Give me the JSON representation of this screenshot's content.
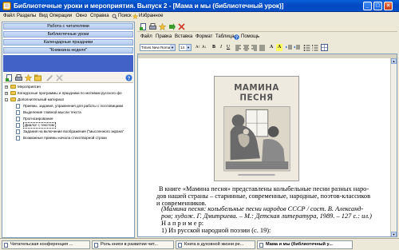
{
  "window": {
    "title": "Библиотечные уроки и мероприятия. Выпуск 2 - [Мама и мы (библиотечный урок)]",
    "controls": {
      "minimize": "_",
      "maximize": "□",
      "close": "×"
    }
  },
  "menubar": [
    "Файл",
    "Разделы",
    "Вид",
    "Операции",
    "Окно",
    "Справка",
    "Поиск",
    "Избранное"
  ],
  "left": {
    "nav": [
      "Работа с читателями",
      "Библиотечные уроки",
      "Календарные праздники",
      "\"Книжкина неделя\""
    ],
    "tree": [
      {
        "label": "Мероприятия",
        "kind": "folder",
        "expander": "+"
      },
      {
        "label": "Конкурсные программы и праздники по мотивам русского фо",
        "kind": "folder",
        "expander": "+"
      },
      {
        "label": "Дополнительный материал",
        "kind": "folder",
        "expander": "-"
      },
      {
        "label": "Приемы, задания, упражнения для работы с пословицами",
        "kind": "doc"
      },
      {
        "label": "Выделение главной мысли текста",
        "kind": "doc"
      },
      {
        "label": "Прогнозирование",
        "kind": "doc"
      },
      {
        "label": "Диалог с текстом",
        "kind": "doc",
        "selected": true
      },
      {
        "label": "Задания на включение воображения (\"мысленного экрана\"",
        "kind": "doc"
      },
      {
        "label": "Возможные приемы начала стихотворной строки",
        "kind": "doc"
      }
    ]
  },
  "right": {
    "menu": [
      "Файл",
      "Правка",
      "Вставка",
      "Формат",
      "Таблица",
      "Помощь"
    ],
    "font_name": "Times New Roma",
    "font_size": "14",
    "format_buttons": [
      "B",
      "I",
      "U",
      "A",
      "A"
    ],
    "cover": {
      "title": "МАМИНА\nПЕСНЯ"
    },
    "text": {
      "p1_l1": "В книге «Мамина песня» представлены колыбельные песни разных наро-",
      "p1_l2": "дов нашей страны – старинные, современные, народные, поэтов-классиков",
      "p1_l3": "и современников.",
      "cap_l1": "(Мамина песня: колыбельные песни народов СССР / сост. В. Александ-",
      "cap_l2": "ров; худож. Г. Дмитриева. – М.: Детская литература, 1989. – 127 с.: ил.)",
      "ex": "Н а п р и м е р:",
      "li1": "1) Из русской народной поэзии (с. 19):"
    }
  },
  "taskbar": [
    {
      "label": "Читательская конференция ..."
    },
    {
      "label": "Роль книги в развитии чит..."
    },
    {
      "label": "Книга в духовной жизни ре..."
    },
    {
      "label": "Мама и мы (библиотечный у...",
      "active": true
    }
  ],
  "colors": {
    "titlebar": "#0348c0",
    "nav_button": "#b4cbee",
    "nav_panel": "#4262c8",
    "accent_green": "#3a9a2a"
  }
}
